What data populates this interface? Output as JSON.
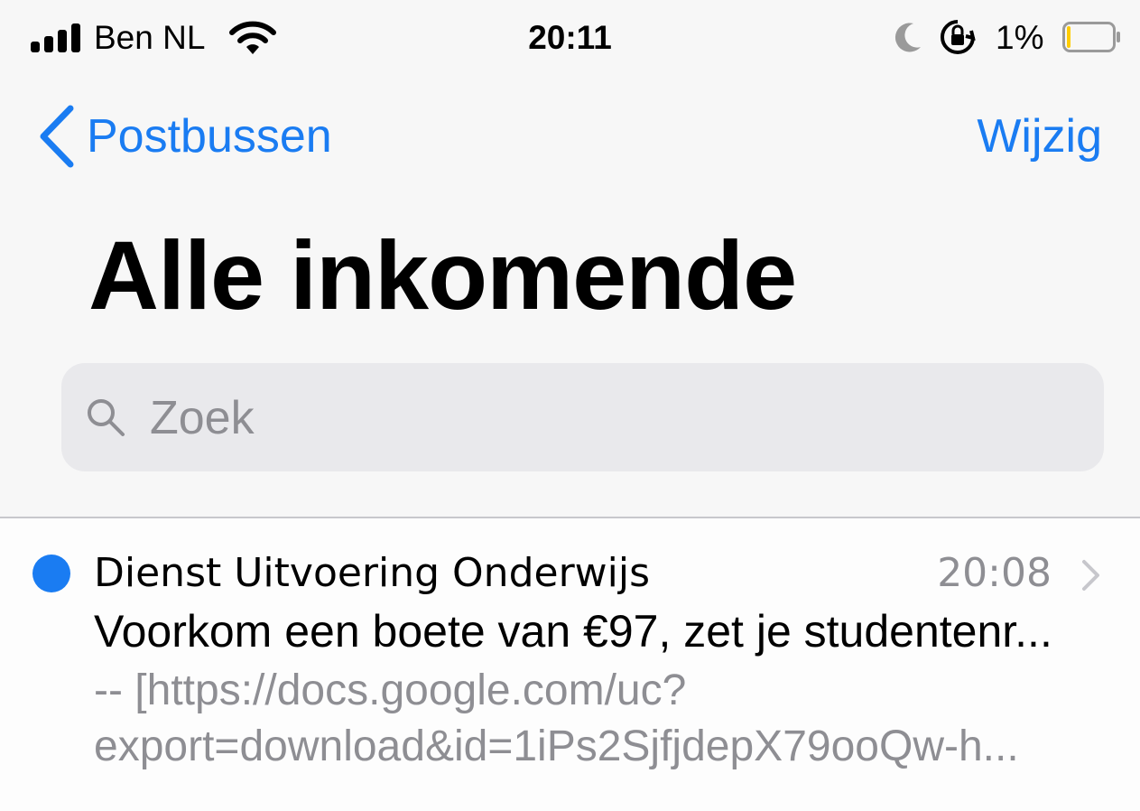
{
  "status_bar": {
    "carrier": "Ben NL",
    "time": "20:11",
    "battery_percent": "1%",
    "battery_level": 0.01,
    "icons": [
      "signal-icon",
      "wifi-icon",
      "moon-icon",
      "orientation-lock-icon",
      "battery-icon"
    ]
  },
  "nav": {
    "back_label": "Postbussen",
    "edit_label": "Wijzig"
  },
  "title": "Alle inkomende",
  "search": {
    "placeholder": "Zoek"
  },
  "messages": [
    {
      "unread": true,
      "sender": "Dienst Uitvoering Onderwijs",
      "time": "20:08",
      "subject": "Voorkom een boete van €97, zet je studentenr...",
      "preview_line1": "-- [https://docs.google.com/uc?",
      "preview_line2": "export=download&id=1iPs2SjfjdepX79ooQw-h..."
    }
  ],
  "colors": {
    "accent": "#1a7cf2",
    "secondary_text": "#8e8e93",
    "background": "#f7f7f7",
    "search_field": "#e9e9ec"
  }
}
